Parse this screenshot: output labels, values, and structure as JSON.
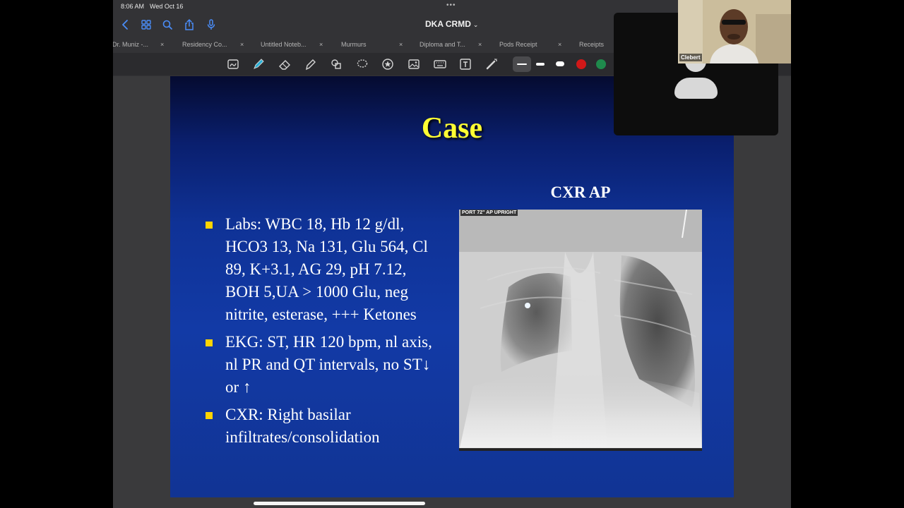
{
  "status_bar": {
    "time": "8:06 AM",
    "date": "Wed Oct 16",
    "dots": "•••"
  },
  "nav": {
    "title": "DKA CRMD",
    "title_chevron": "⌄"
  },
  "tabs": [
    {
      "label": "Dr. Muniz -...",
      "close": "×"
    },
    {
      "label": "Residency Co...",
      "close": "×"
    },
    {
      "label": "Untitled Noteb...",
      "close": "×"
    },
    {
      "label": "Murmurs",
      "close": "×"
    },
    {
      "label": "Diploma and T...",
      "close": "×"
    },
    {
      "label": "Pods Receipt",
      "close": "×"
    },
    {
      "label": "Receipts",
      "close": ""
    }
  ],
  "toolbar": {
    "tools": [
      "scan-document-icon",
      "pen-icon",
      "eraser-icon",
      "highlighter-icon",
      "shapes-icon",
      "lasso-icon",
      "sticker-icon",
      "image-icon",
      "keyboard-icon",
      "text-box-icon",
      "laser-pointer-icon"
    ],
    "colors": [
      "#d01818",
      "#1f8a4c"
    ]
  },
  "slide": {
    "title": "Case",
    "bullets": [
      "Labs: WBC 18, Hb 12 g/dl, HCO3 13, Na 131, Glu 564, Cl 89, K+3.1, AG 29, pH 7.12, BOH 5,UA > 1000 Glu, neg nitrite, esterase, +++ Ketones",
      "EKG: ST, HR 120 bpm, nl axis, nl PR and QT intervals, no ST↓ or ↑",
      "CXR: Right basilar infiltrates/consolidation"
    ],
    "image_label": "CXR AP",
    "image_caption": "PORT 72\" AP UPRIGHT"
  },
  "video": {
    "participant_name": "Clebert"
  }
}
